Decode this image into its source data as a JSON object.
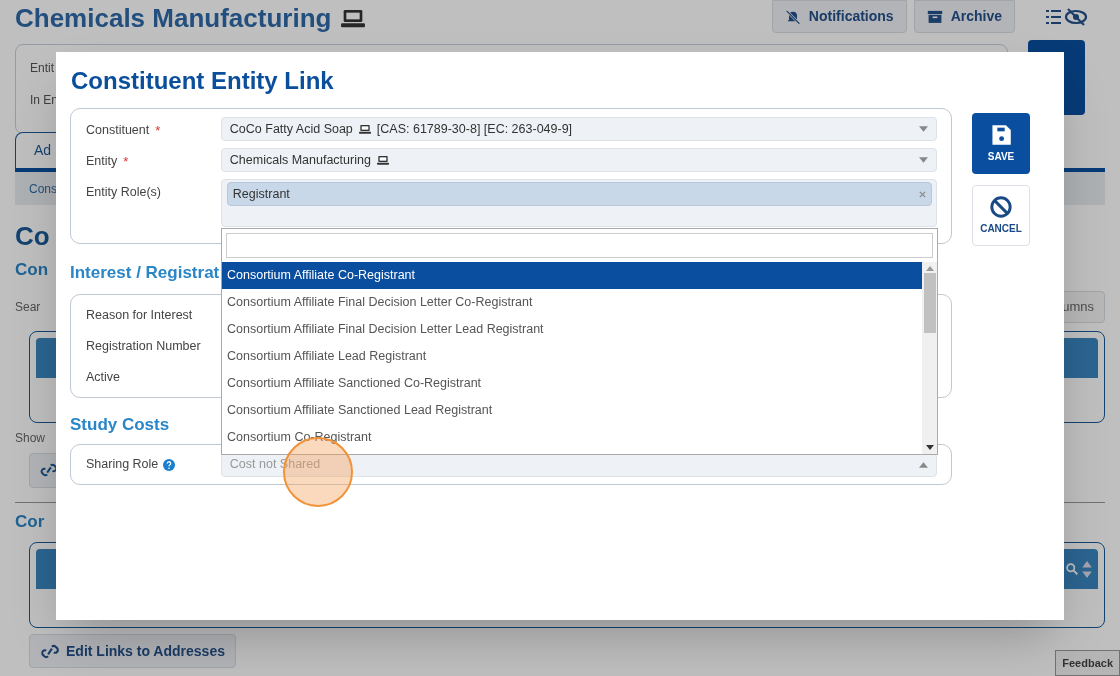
{
  "background": {
    "title": "Chemicals Manufacturing",
    "header_buttons": [
      {
        "label": "Notifications",
        "kind": "notifications"
      },
      {
        "label": "Archive",
        "kind": "archive"
      }
    ],
    "info_labels": [
      "Entit",
      "In En"
    ],
    "tab": {
      "label": "Ad",
      "selected": true
    },
    "subbar": "Cons",
    "section_heading": "Co",
    "subheading": "Con",
    "search_label": "Sear",
    "columns_button": "umns",
    "show_label": "Show",
    "heading_2": "Cor",
    "edit_links_button": "Edit Links to Addresses",
    "feedback": "Feedback"
  },
  "modal": {
    "title": "Constituent Entity Link",
    "fields": [
      {
        "label": "Constituent",
        "required_mark": "*",
        "kind": "select",
        "value": "CoCo Fatty Acid Soap",
        "suffix": "[CAS: 61789-30-8] [EC: 263-049-9]"
      },
      {
        "label": "Entity",
        "required_mark": "*",
        "kind": "select",
        "value": "Chemicals Manufacturing"
      },
      {
        "label": "Entity Role(s)",
        "kind": "tags",
        "tags": [
          "Registrant"
        ]
      }
    ],
    "dropdown": {
      "options": [
        {
          "label": "Consortium Affiliate Co-Registrant",
          "selected": true
        },
        {
          "label": "Consortium Affiliate Final Decision Letter Co-Registrant",
          "selected": false
        },
        {
          "label": "Consortium Affiliate Final Decision Letter Lead Registrant",
          "selected": false
        },
        {
          "label": "Consortium Affiliate Lead Registrant",
          "selected": false
        },
        {
          "label": "Consortium Affiliate Sanctioned Co-Registrant",
          "selected": false
        },
        {
          "label": "Consortium Affiliate Sanctioned Lead Registrant",
          "selected": false
        },
        {
          "label": "Consortium Co-Registrant",
          "selected": false
        }
      ]
    },
    "interest": {
      "heading": "Interest / Registrat",
      "labels": [
        "Reason for Interest",
        "Registration Number",
        "Active"
      ]
    },
    "study_costs": {
      "heading": "Study Costs",
      "field": {
        "label": "Sharing Role",
        "placeholder": "Cost not Shared"
      }
    },
    "actions": [
      {
        "label": "SAVE",
        "kind": "save"
      },
      {
        "label": "CANCEL",
        "kind": "cancel"
      }
    ]
  }
}
